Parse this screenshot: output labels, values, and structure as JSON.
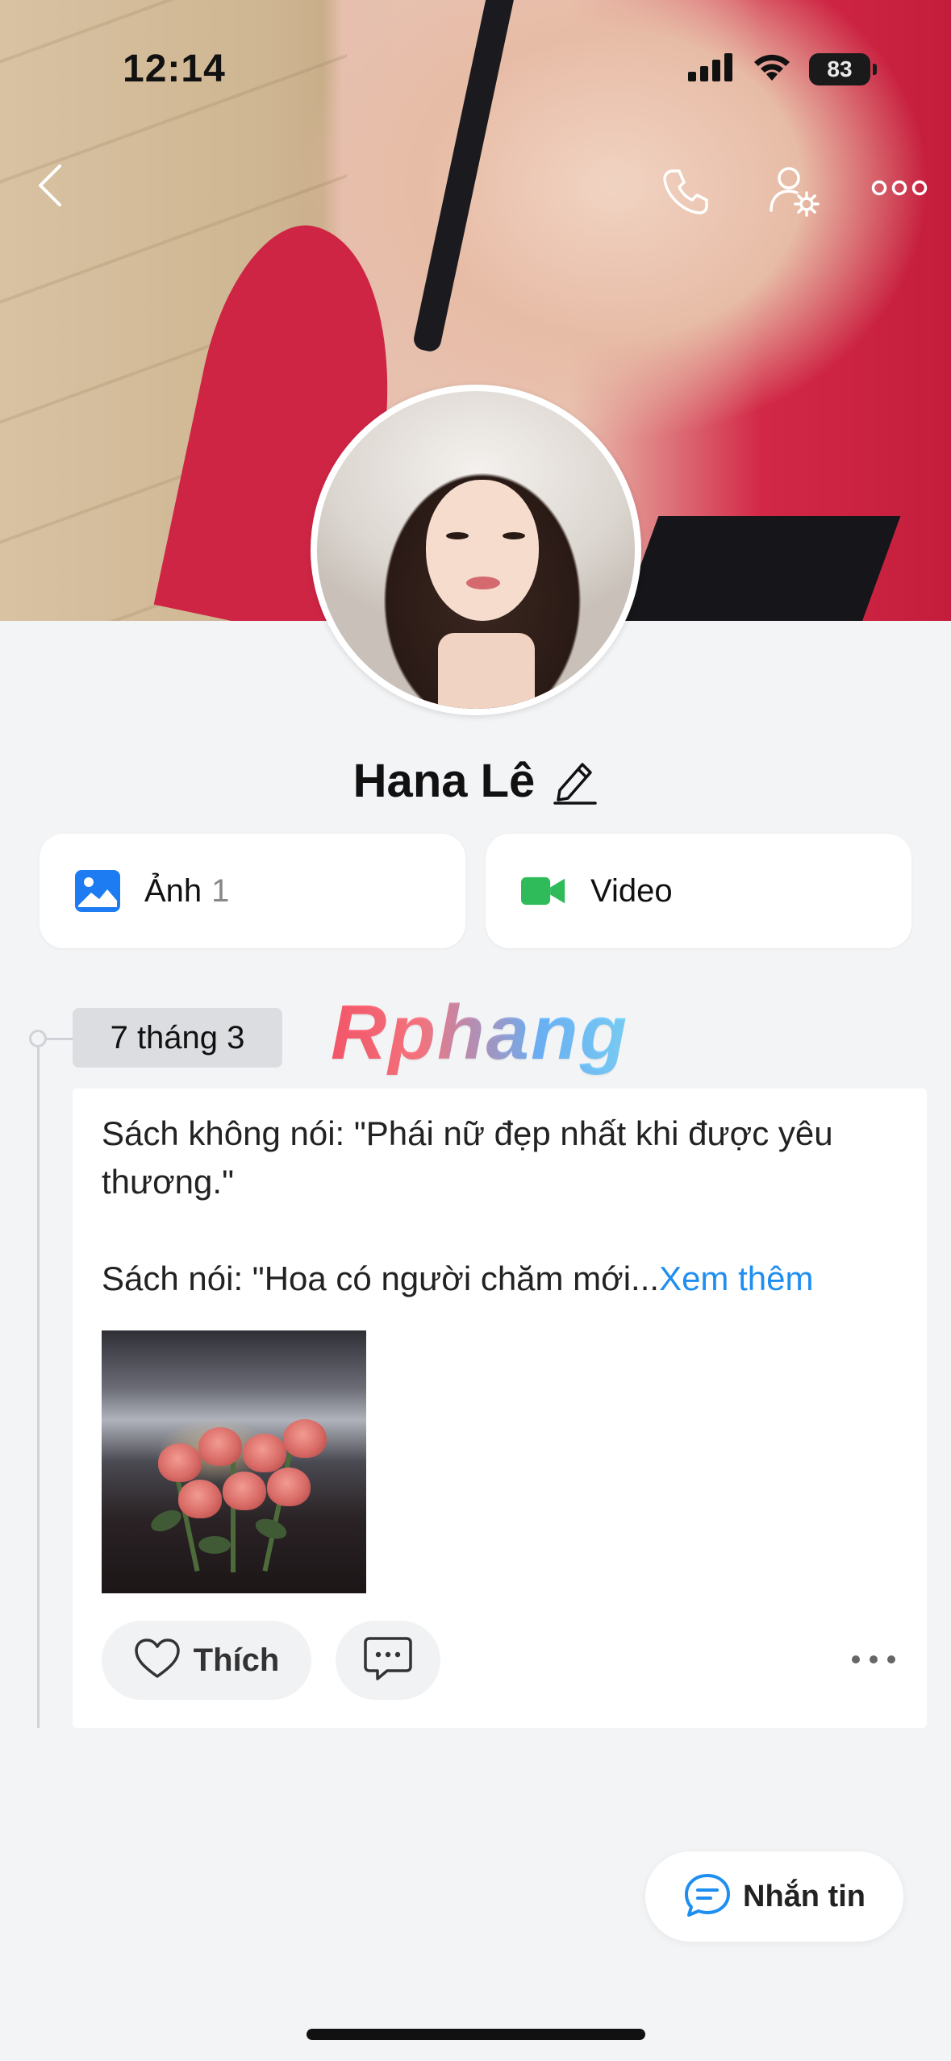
{
  "status_bar": {
    "time": "12:14",
    "battery": "83",
    "icons": [
      "signal-icon",
      "wifi-icon",
      "battery-icon"
    ]
  },
  "nav": {
    "icons": [
      "back-chevron-icon",
      "phone-icon",
      "user-settings-icon",
      "more-horizontal-icon"
    ]
  },
  "profile": {
    "name": "Hana Lê"
  },
  "media": {
    "photos_label": "Ảnh",
    "photos_count": "1",
    "video_label": "Video",
    "colors": {
      "photos": "#1e7cf2",
      "video": "#2fbb5a"
    }
  },
  "timeline": {
    "date": "7 tháng 3",
    "watermark": "Rphang"
  },
  "post": {
    "line1": "Sách không nói: \"Phái nữ đẹp nhất khi được yêu thương.\"",
    "line2": "Sách nói: \"Hoa có người chăm mới...",
    "see_more": "Xem thêm",
    "like_label": "Thích"
  },
  "fab": {
    "label": "Nhắn tin",
    "color": "#1f8ef1"
  }
}
